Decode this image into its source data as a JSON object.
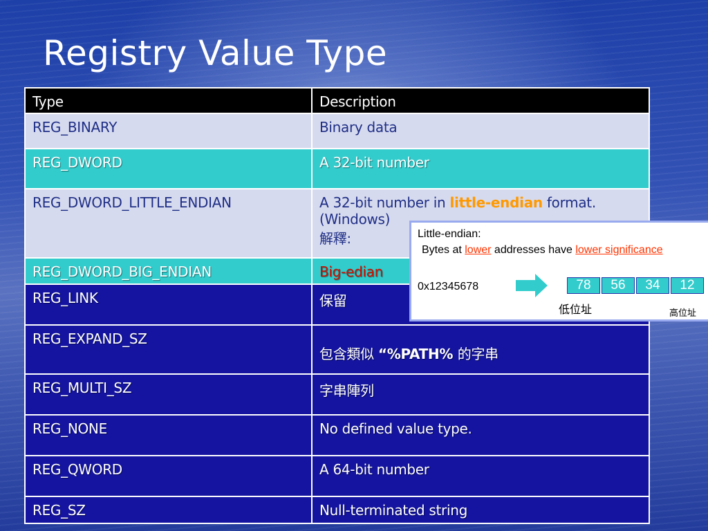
{
  "slide": {
    "title": "Registry Value Type"
  },
  "table": {
    "headers": [
      "Type",
      "Description"
    ],
    "rows": [
      {
        "type": "REG_BINARY",
        "desc": "Binary data"
      },
      {
        "type": "REG_DWORD",
        "desc": "A 32-bit number"
      },
      {
        "type": "REG_DWORD_LITTLE_ENDIAN",
        "desc_prefix": "A 32-bit number in ",
        "desc_highlight": "little-endian",
        "desc_suffix": " format.",
        "desc_line2": "(Windows)",
        "desc_line3": "解釋:"
      },
      {
        "type": "REG_DWORD_BIG_ENDIAN",
        "desc": "Big-edian"
      },
      {
        "type": "REG_LINK",
        "desc": "保留"
      },
      {
        "type": "REG_EXPAND_SZ",
        "desc_prefix": "包含類似 ",
        "desc_bold": "“%PATH% ",
        "desc_suffix": "的字串"
      },
      {
        "type": "REG_MULTI_SZ",
        "desc": "字串陣列"
      },
      {
        "type": "REG_NONE",
        "desc": "No defined value type."
      },
      {
        "type": "REG_QWORD",
        "desc": "A 64-bit number"
      },
      {
        "type": "REG_SZ",
        "desc": "Null-terminated string"
      }
    ]
  },
  "popup": {
    "heading": "Little-endian:",
    "line2_a": "Bytes at ",
    "line2_b": "lower",
    "line2_c": " addresses have ",
    "line2_d": "lower significance",
    "hex": "0x12345678",
    "bytes": [
      "78",
      "56",
      "34",
      "12"
    ],
    "low_address_label": "低位址",
    "high_address_label": "高位址"
  },
  "colors": {
    "header_bg": "#000000",
    "light_row_bg": "#d6daee",
    "cyan_row_bg": "#33cccc",
    "dark_row_bg": "#1414a0",
    "highlight_orange": "#ff9900",
    "highlight_red": "#cc1100"
  }
}
